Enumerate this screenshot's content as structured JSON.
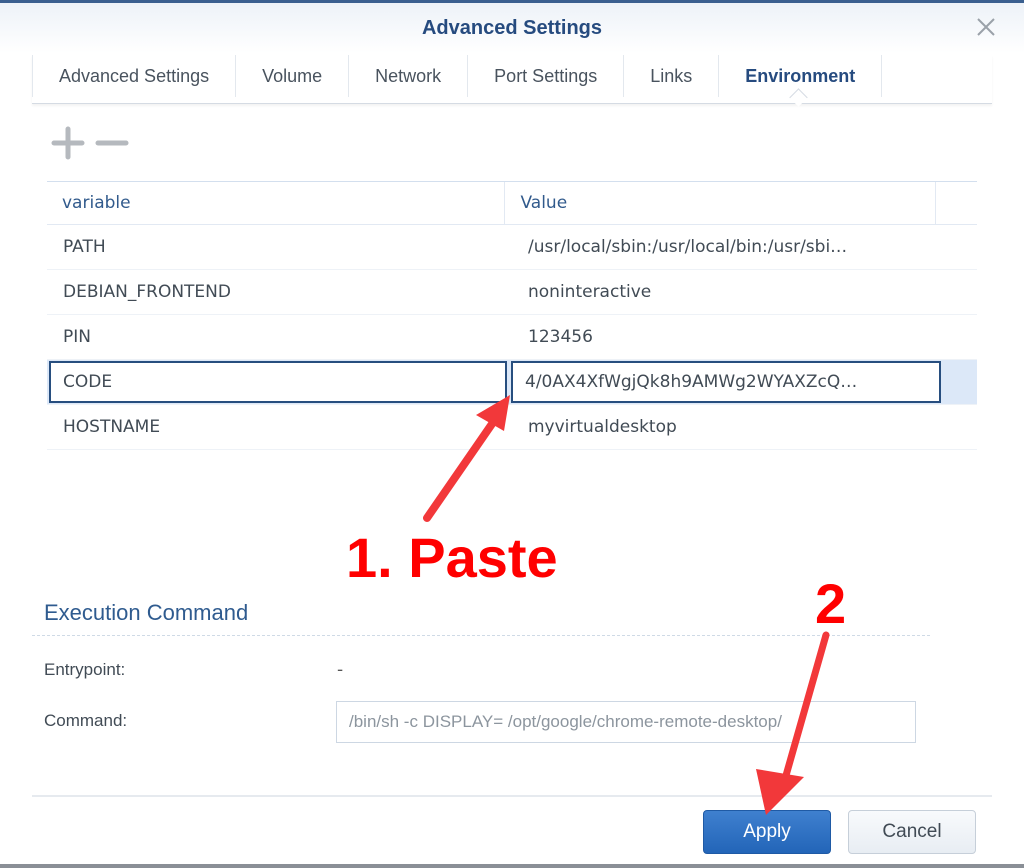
{
  "dialog": {
    "title": "Advanced Settings",
    "close_icon": "close-icon"
  },
  "tabs": [
    {
      "label": "Advanced Settings",
      "active": false
    },
    {
      "label": "Volume",
      "active": false
    },
    {
      "label": "Network",
      "active": false
    },
    {
      "label": "Port Settings",
      "active": false
    },
    {
      "label": "Links",
      "active": false
    },
    {
      "label": "Environment",
      "active": true
    }
  ],
  "toolbar": {
    "add_icon": "plus-icon",
    "remove_icon": "minus-icon"
  },
  "env_table": {
    "columns": [
      "variable",
      "Value"
    ],
    "rows": [
      {
        "variable": "PATH",
        "value": "/usr/local/sbin:/usr/local/bin:/usr/sbi…",
        "selected": false
      },
      {
        "variable": "DEBIAN_FRONTEND",
        "value": "noninteractive",
        "selected": false
      },
      {
        "variable": "PIN",
        "value": "123456",
        "selected": false
      },
      {
        "variable": "CODE",
        "value": "4/0AX4XfWgjQk8h9AMWg2WYAXZcQ…",
        "selected": true
      },
      {
        "variable": "HOSTNAME",
        "value": "myvirtualdesktop",
        "selected": false
      }
    ]
  },
  "execution": {
    "title": "Execution Command",
    "entrypoint_label": "Entrypoint:",
    "entrypoint_value": "-",
    "command_label": "Command:",
    "command_value": "/bin/sh -c DISPLAY= /opt/google/chrome-remote-desktop/"
  },
  "footer": {
    "apply_label": "Apply",
    "cancel_label": "Cancel"
  },
  "annotations": {
    "step1": "1. Paste",
    "step2": "2",
    "color": "#ff0000"
  },
  "colors": {
    "accent": "#264b7f",
    "primary_button": "#2a6ec1",
    "selected_row": "#dce8f8"
  }
}
